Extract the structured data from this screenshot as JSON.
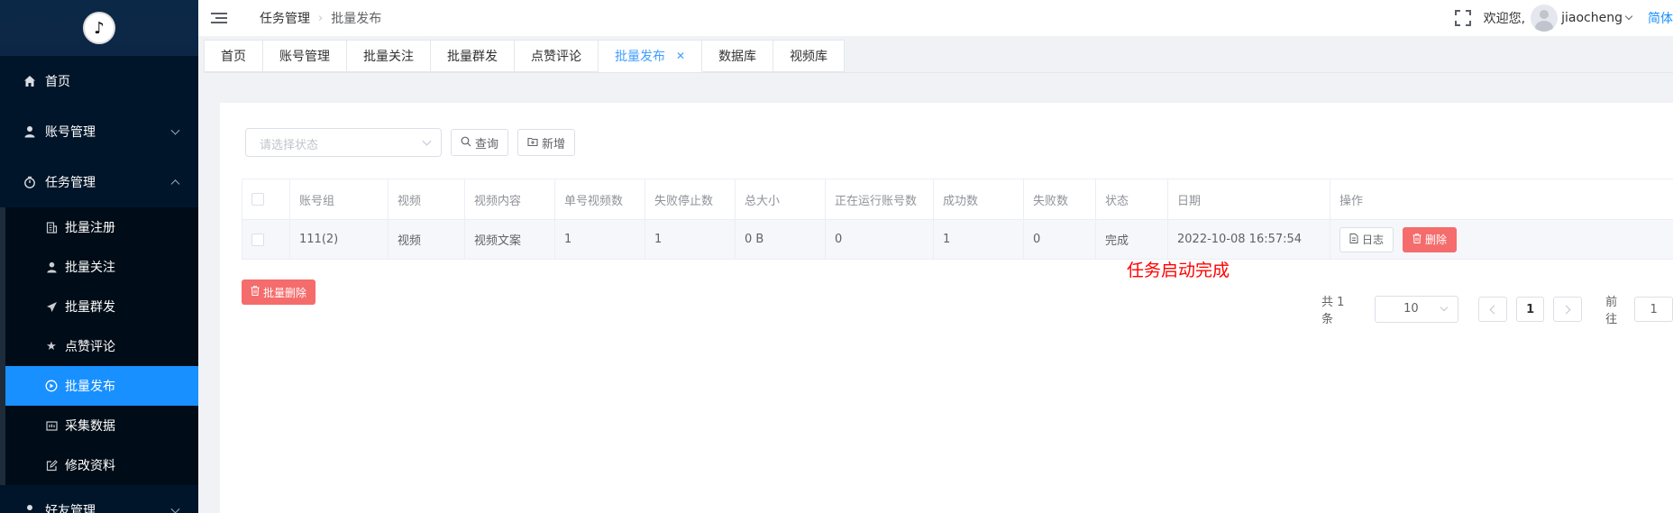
{
  "sidebar": {
    "logo_icon": "tiktok-note-icon",
    "menu": [
      {
        "label": "首页",
        "icon": "home-icon"
      },
      {
        "label": "账号管理",
        "icon": "user-icon"
      },
      {
        "label": "任务管理",
        "icon": "timer-icon"
      }
    ],
    "submenu": [
      {
        "label": "批量注册",
        "icon": "document-icon"
      },
      {
        "label": "批量关注",
        "icon": "user-icon"
      },
      {
        "label": "批量群发",
        "icon": "send-icon"
      },
      {
        "label": "点赞评论",
        "icon": "star-icon"
      },
      {
        "label": "批量发布",
        "icon": "play-circle-icon"
      },
      {
        "label": "采集数据",
        "icon": "data-icon"
      },
      {
        "label": "修改资料",
        "icon": "edit-icon"
      }
    ],
    "bottom_menu": {
      "label": "好友管理",
      "icon": "friends-icon"
    },
    "active_color": "#1890ff",
    "bg_color": "#001529"
  },
  "header": {
    "breadcrumb": [
      "任务管理",
      "批量发布"
    ],
    "welcome": "欢迎您,",
    "username": "jiaocheng",
    "lang": "简体"
  },
  "tabs": [
    {
      "label": "首页"
    },
    {
      "label": "账号管理"
    },
    {
      "label": "批量关注"
    },
    {
      "label": "批量群发"
    },
    {
      "label": "点赞评论"
    },
    {
      "label": "批量发布",
      "active": true
    },
    {
      "label": "数据库"
    },
    {
      "label": "视频库"
    }
  ],
  "toolbar": {
    "status_placeholder": "请选择状态",
    "query_label": "查询",
    "add_label": "新增"
  },
  "table": {
    "columns": [
      "账号组",
      "视频",
      "视频内容",
      "单号视频数",
      "失败停止数",
      "总大小",
      "正在运行账号数",
      "成功数",
      "失败数",
      "状态",
      "日期",
      "操作"
    ],
    "rows": [
      [
        "111(2)",
        "视频",
        "视频文案",
        "1",
        "1",
        "0 B",
        "0",
        "1",
        "0",
        "完成",
        "2022-10-08 16:57:54"
      ]
    ],
    "log_label": "日志",
    "delete_label": "删除"
  },
  "notice": "任务启动完成",
  "batch_delete_label": "批量删除",
  "pagination": {
    "total": "共 1 条",
    "page_size": "10",
    "current_page": "1",
    "goto_label": "前往",
    "goto_value": "1"
  },
  "colors": {
    "primary": "#409eff",
    "danger": "#f56c6c",
    "notice": "#ff0000"
  }
}
